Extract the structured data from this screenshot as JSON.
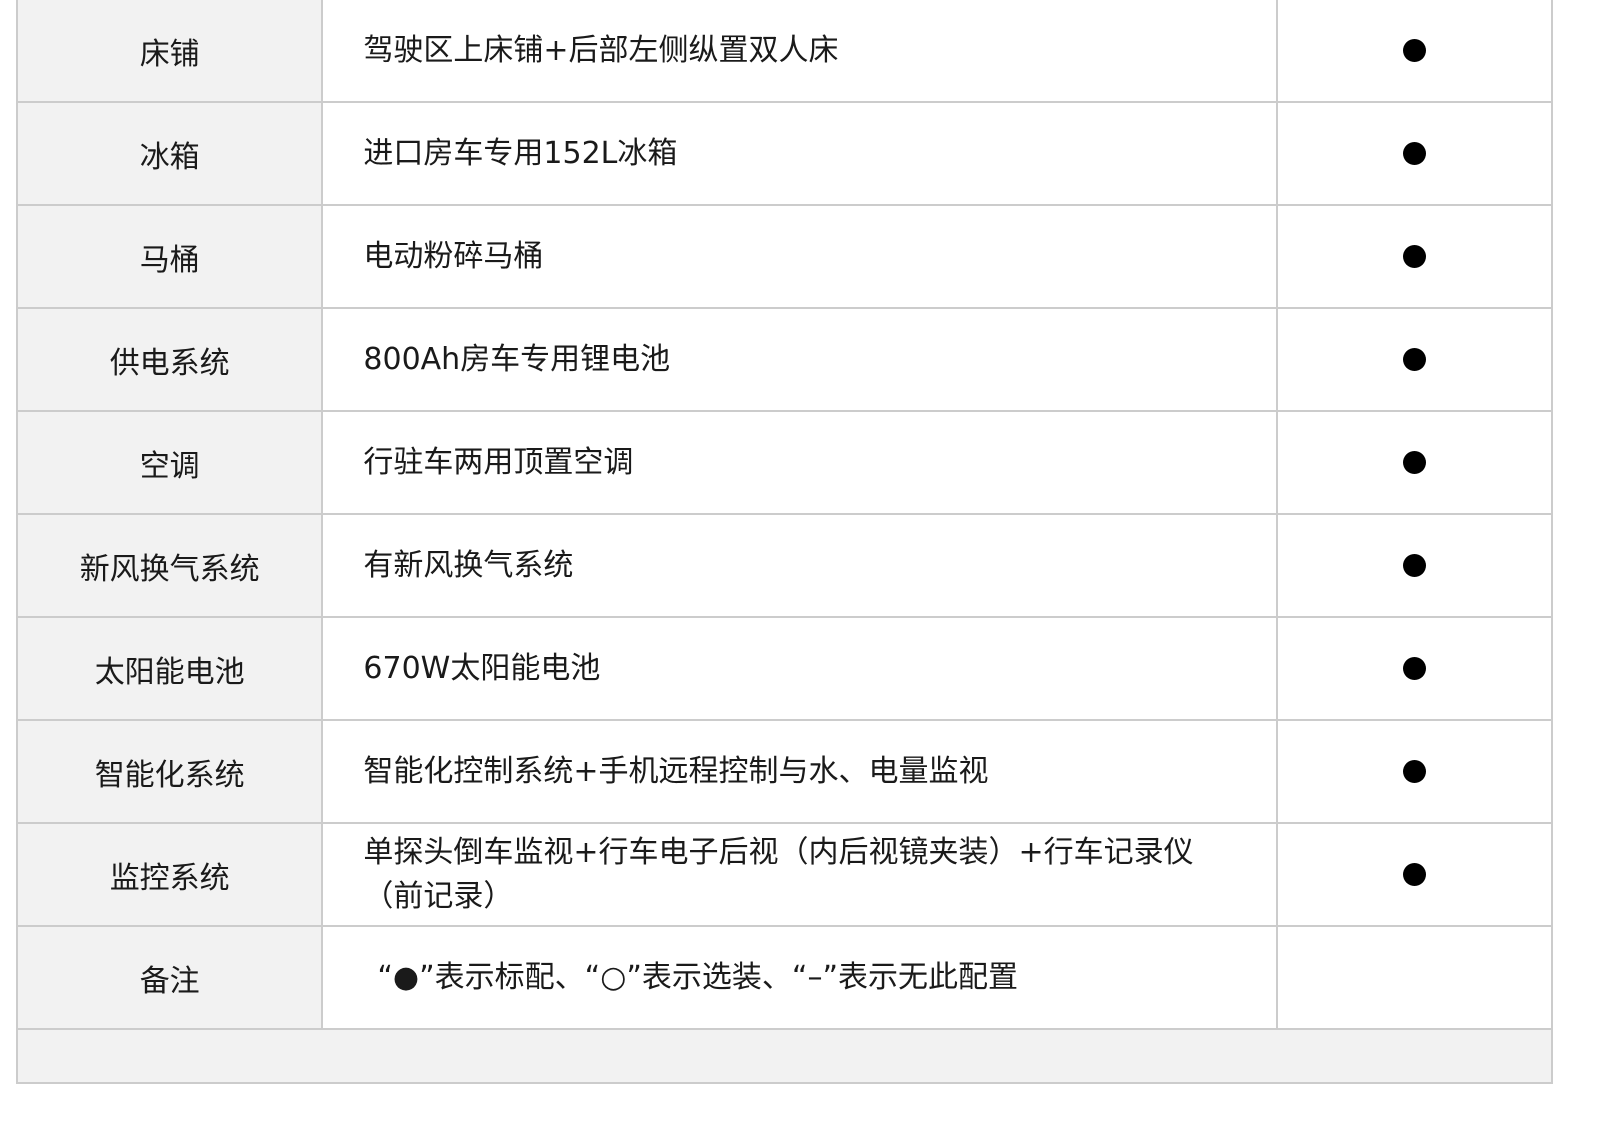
{
  "rows": [
    {
      "label": "床铺",
      "desc": "驾驶区上床铺+后部左侧纵置双人床",
      "mark": "●"
    },
    {
      "label": "冰箱",
      "desc": "进口房车专用152L冰箱",
      "mark": "●"
    },
    {
      "label": "马桶",
      "desc": "电动粉碎马桶",
      "mark": "●"
    },
    {
      "label": "供电系统",
      "desc": "800Ah房车专用锂电池",
      "mark": "●"
    },
    {
      "label": "空调",
      "desc": "行驻车两用顶置空调",
      "mark": "●"
    },
    {
      "label": "新风换气系统",
      "desc": "有新风换气系统",
      "mark": "●"
    },
    {
      "label": "太阳能电池",
      "desc": "670W太阳能电池",
      "mark": "●"
    },
    {
      "label": "智能化系统",
      "desc": "智能化控制系统+手机远程控制与水、电量监视",
      "mark": "●"
    },
    {
      "label": "监控系统",
      "desc": "单探头倒车监视+行车电子后视（内后视镜夹装）+行车记录仪（前记录）",
      "mark": "●"
    }
  ],
  "note": {
    "label": "备注",
    "text": "“●”表示标配、“○”表示选装、“–”表示无此配置"
  }
}
